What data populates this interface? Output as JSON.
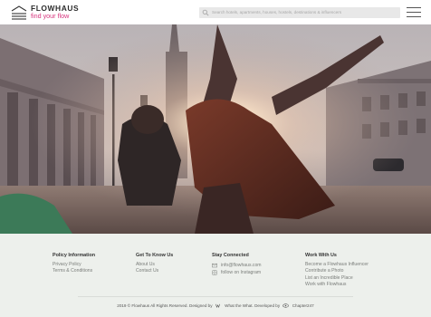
{
  "brand": {
    "name": "FLOWHAUS",
    "tagline": "find your flow",
    "logo_icon": "house-outline-icon",
    "accent": "#d6337c"
  },
  "search": {
    "placeholder": "Search hotels, apartments, houses, hostels, destinations & influencers",
    "icon": "search-icon"
  },
  "menu": {
    "icon": "hamburger-menu-icon"
  },
  "hero": {
    "image": "woman-dancing-in-sunlight-city-street"
  },
  "footer": {
    "columns": [
      {
        "title": "Policy Information",
        "links": [
          "Privacy Policy",
          "Terms & Conditions"
        ]
      },
      {
        "title": "Get To Know Us",
        "links": [
          "About Us",
          "Contact Us"
        ]
      },
      {
        "title": "Stay Connected",
        "links": [
          "info@flowhaus.com",
          "follow on Instagram"
        ]
      },
      {
        "title": "Work With Us",
        "links": [
          "Become a Flowhaus Influencer",
          "Contribute a Photo",
          "List an Incredible Place",
          "Work with Flowhaus"
        ]
      }
    ],
    "copyright": {
      "prefix": "2019 © Flowhaus All Rights Reserved. Designed by",
      "designer": "What the What.",
      "middle": "Developed by",
      "developer": "Chapter247"
    },
    "background": "#edf0ec"
  }
}
